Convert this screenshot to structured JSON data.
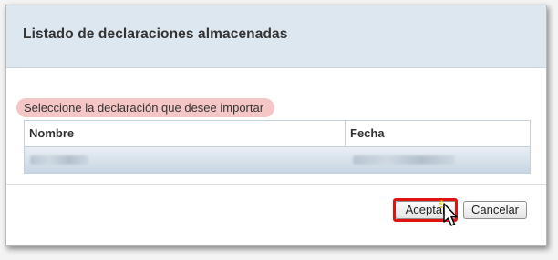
{
  "dialog": {
    "title": "Listado de declaraciones almacenadas",
    "instruction": "Seleccione la declaración que desee importar",
    "table": {
      "columns": [
        "Nombre",
        "Fecha"
      ],
      "rows": [
        {
          "nombre": "",
          "fecha": "",
          "selected": true
        }
      ]
    },
    "buttons": {
      "accept_label": "Aceptar",
      "cancel_label": "Cancelar"
    }
  },
  "colors": {
    "titlebar": "#dde7ef",
    "instruction_highlight": "#f4c6c6",
    "selected_row": "#d3dfe9",
    "focus_outline": "#e01212"
  },
  "icons": [
    "pointer-cursor-icon"
  ]
}
